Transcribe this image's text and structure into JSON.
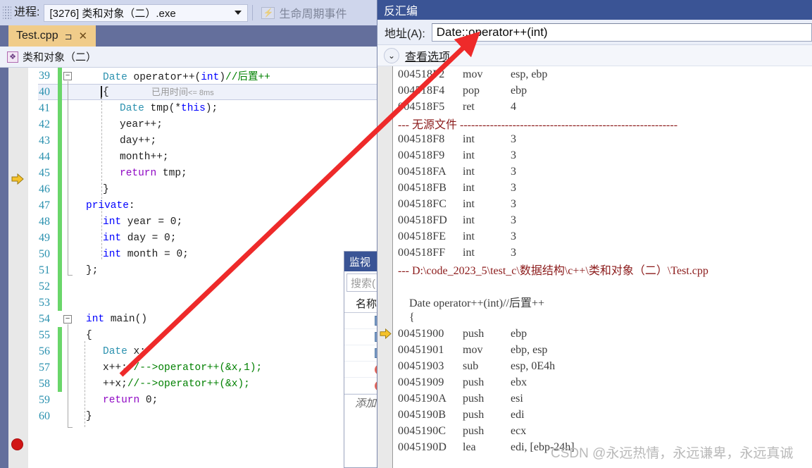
{
  "toolbar": {
    "process_label": "进程:",
    "process_value": "[3276] 类和对象（二）.exe",
    "lifecycle_label": "生命周期事件",
    "lifecycle_icon": "lightning-icon",
    "dropdown_icon": "chevron-down-icon",
    "grip_icon": "drag-grip-icon"
  },
  "editor": {
    "tab": {
      "filename": "Test.cpp",
      "pin_icon": "pin-icon",
      "close_icon": "close-icon"
    },
    "navbar": {
      "class_icon": "class-scope-icon",
      "scope": "类和对象（二）"
    },
    "inline_hint": {
      "label": "已用时间",
      "value": "<= 8ms"
    },
    "breakpoint_line": 56,
    "current_line": 40,
    "lines": [
      {
        "n": "39",
        "changed": true,
        "fold": "minus",
        "indent": 0,
        "tokens": [
          {
            "t": "Date ",
            "c": "typ"
          },
          {
            "t": "operator++(",
            "c": "plain"
          },
          {
            "t": "int",
            "c": "kw"
          },
          {
            "t": ")",
            "c": "plain"
          },
          {
            "t": "//后置++",
            "c": "cmt"
          }
        ]
      },
      {
        "n": "40",
        "changed": true,
        "fold": "",
        "indent": 0,
        "tokens": [
          {
            "t": "{",
            "c": "plain"
          }
        ]
      },
      {
        "n": "41",
        "changed": true,
        "fold": "",
        "indent": 1,
        "tokens": [
          {
            "t": "Date ",
            "c": "typ"
          },
          {
            "t": "tmp(*",
            "c": "plain"
          },
          {
            "t": "this",
            "c": "kw"
          },
          {
            "t": ");",
            "c": "plain"
          }
        ]
      },
      {
        "n": "42",
        "changed": true,
        "fold": "",
        "indent": 1,
        "tokens": [
          {
            "t": "year++;",
            "c": "plain"
          }
        ]
      },
      {
        "n": "43",
        "changed": true,
        "fold": "",
        "indent": 1,
        "tokens": [
          {
            "t": "day++;",
            "c": "plain"
          }
        ]
      },
      {
        "n": "44",
        "changed": true,
        "fold": "",
        "indent": 1,
        "tokens": [
          {
            "t": "month++;",
            "c": "plain"
          }
        ]
      },
      {
        "n": "45",
        "changed": true,
        "fold": "",
        "indent": 1,
        "tokens": [
          {
            "t": "return",
            "c": "ctl"
          },
          {
            "t": " tmp;",
            "c": "plain"
          }
        ]
      },
      {
        "n": "46",
        "changed": true,
        "fold": "",
        "indent": 0,
        "tokens": [
          {
            "t": "}",
            "c": "plain"
          }
        ]
      },
      {
        "n": "47",
        "changed": true,
        "fold": "",
        "indent": -1,
        "tokens": [
          {
            "t": "private",
            "c": "kw"
          },
          {
            "t": ":",
            "c": "plain"
          }
        ]
      },
      {
        "n": "48",
        "changed": true,
        "fold": "",
        "indent": 0,
        "tokens": [
          {
            "t": "int",
            "c": "kw"
          },
          {
            "t": " year = ",
            "c": "plain"
          },
          {
            "t": "0",
            "c": "num"
          },
          {
            "t": ";",
            "c": "plain"
          }
        ]
      },
      {
        "n": "49",
        "changed": true,
        "fold": "",
        "indent": 0,
        "tokens": [
          {
            "t": "int",
            "c": "kw"
          },
          {
            "t": " day = ",
            "c": "plain"
          },
          {
            "t": "0",
            "c": "num"
          },
          {
            "t": ";",
            "c": "plain"
          }
        ]
      },
      {
        "n": "50",
        "changed": true,
        "fold": "",
        "indent": 0,
        "tokens": [
          {
            "t": "int",
            "c": "kw"
          },
          {
            "t": " month = ",
            "c": "plain"
          },
          {
            "t": "0",
            "c": "num"
          },
          {
            "t": ";",
            "c": "plain"
          }
        ]
      },
      {
        "n": "51",
        "changed": true,
        "fold": "",
        "indent": -1,
        "tokens": [
          {
            "t": "};",
            "c": "plain"
          }
        ]
      },
      {
        "n": "52",
        "changed": true,
        "fold": "",
        "indent": -1,
        "tokens": []
      },
      {
        "n": "53",
        "changed": true,
        "fold": "",
        "indent": -1,
        "tokens": []
      },
      {
        "n": "54",
        "changed": false,
        "fold": "minus",
        "indent": -1,
        "tokens": [
          {
            "t": "int",
            "c": "kw"
          },
          {
            "t": " ",
            "c": "plain"
          },
          {
            "t": "main",
            "c": "plain"
          },
          {
            "t": "()",
            "c": "plain"
          }
        ]
      },
      {
        "n": "55",
        "changed": true,
        "fold": "",
        "indent": -1,
        "tokens": [
          {
            "t": "{",
            "c": "plain"
          }
        ]
      },
      {
        "n": "56",
        "changed": true,
        "fold": "",
        "indent": 0,
        "tokens": [
          {
            "t": "Date",
            "c": "typ"
          },
          {
            "t": " x;",
            "c": "plain"
          }
        ]
      },
      {
        "n": "57",
        "changed": true,
        "fold": "",
        "indent": 0,
        "tokens": [
          {
            "t": "x++;",
            "c": "plain"
          },
          {
            "t": "//-->operator++(&x,1);",
            "c": "cmt"
          }
        ]
      },
      {
        "n": "58",
        "changed": true,
        "fold": "",
        "indent": 0,
        "tokens": [
          {
            "t": "++x;",
            "c": "plain"
          },
          {
            "t": "//-->operator++(&x);",
            "c": "cmt"
          }
        ]
      },
      {
        "n": "59",
        "changed": false,
        "fold": "",
        "indent": 0,
        "tokens": [
          {
            "t": "return",
            "c": "ctl"
          },
          {
            "t": " ",
            "c": "plain"
          },
          {
            "t": "0",
            "c": "num"
          },
          {
            "t": ";",
            "c": "plain"
          }
        ]
      },
      {
        "n": "60",
        "changed": false,
        "fold": "",
        "indent": -1,
        "tokens": [
          {
            "t": "}",
            "c": "plain"
          }
        ]
      }
    ]
  },
  "watch": {
    "title": "监视",
    "search_placeholder": "搜索(",
    "column_name": "名称",
    "add_row": "添加",
    "row_icons": [
      "object-icon",
      "object-icon",
      "object-icon",
      "error-icon",
      "error-icon"
    ]
  },
  "disassembly": {
    "title": "反汇编",
    "address_label": "地址(A):",
    "address_value": "Date::operator++(int)",
    "view_options_label": "查看选项",
    "view_options_icon": "chevron-down-icon",
    "current_instruction_icon": "yellow-arrow-icon",
    "current_instruction_address": "00451900",
    "no_source_label": "--- 无源文件 ----------------------------------------------------------",
    "source_path_label": "--- D:\\code_2023_5\\test_c\\数据结构\\c++\\类和对象（二）\\Test.cpp",
    "rows": [
      {
        "kind": "code",
        "addr": "004518F2",
        "op": "mov",
        "args": "esp, ebp"
      },
      {
        "kind": "code",
        "addr": "004518F4",
        "op": "pop",
        "args": "ebp"
      },
      {
        "kind": "code",
        "addr": "004518F5",
        "op": "ret",
        "args": "4"
      },
      {
        "kind": "nosrc",
        "addr": "",
        "op": "",
        "args": ""
      },
      {
        "kind": "code",
        "addr": "004518F8",
        "op": "int",
        "args": "3"
      },
      {
        "kind": "code",
        "addr": "004518F9",
        "op": "int",
        "args": "3"
      },
      {
        "kind": "code",
        "addr": "004518FA",
        "op": "int",
        "args": "3"
      },
      {
        "kind": "code",
        "addr": "004518FB",
        "op": "int",
        "args": "3"
      },
      {
        "kind": "code",
        "addr": "004518FC",
        "op": "int",
        "args": "3"
      },
      {
        "kind": "code",
        "addr": "004518FD",
        "op": "int",
        "args": "3"
      },
      {
        "kind": "code",
        "addr": "004518FE",
        "op": "int",
        "args": "3"
      },
      {
        "kind": "code",
        "addr": "004518FF",
        "op": "int",
        "args": "3"
      },
      {
        "kind": "path",
        "addr": "",
        "op": "",
        "args": ""
      },
      {
        "kind": "blank",
        "addr": "",
        "op": "",
        "args": ""
      },
      {
        "kind": "src",
        "addr": "",
        "op": "",
        "args": "    Date operator++(int)//后置++"
      },
      {
        "kind": "src",
        "addr": "",
        "op": "",
        "args": "    {"
      },
      {
        "kind": "code",
        "addr": "00451900",
        "op": "push",
        "args": "ebp",
        "current": true
      },
      {
        "kind": "code",
        "addr": "00451901",
        "op": "mov",
        "args": "ebp, esp"
      },
      {
        "kind": "code",
        "addr": "00451903",
        "op": "sub",
        "args": "esp, 0E4h"
      },
      {
        "kind": "code",
        "addr": "00451909",
        "op": "push",
        "args": "ebx"
      },
      {
        "kind": "code",
        "addr": "0045190A",
        "op": "push",
        "args": "esi"
      },
      {
        "kind": "code",
        "addr": "0045190B",
        "op": "push",
        "args": "edi"
      },
      {
        "kind": "code",
        "addr": "0045190C",
        "op": "push",
        "args": "ecx"
      },
      {
        "kind": "code",
        "addr": "0045190D",
        "op": "lea",
        "args": "edi, [ebp-24h]"
      }
    ]
  },
  "annotation": {
    "arrow_color": "#ee2a2a",
    "arrow_name": "red-pointer-arrow"
  },
  "watermark": {
    "text": "CSDN @永远热情，永远谦卑，永远真诚"
  },
  "colors": {
    "toolbar_bg": "#cfd6ec",
    "tabstrip_bg": "#646f9c",
    "active_tab_bg": "#f0cc8a",
    "panel_title_bg": "#3a5495",
    "changed_bar": "#6ad66a",
    "breakpoint": "#d11515",
    "keyword": "#0000ff",
    "type": "#2b91af",
    "comment": "#008000",
    "control": "#8f08c4",
    "linenum": "#2b91af",
    "disasm_sep": "#8b1a1a"
  }
}
